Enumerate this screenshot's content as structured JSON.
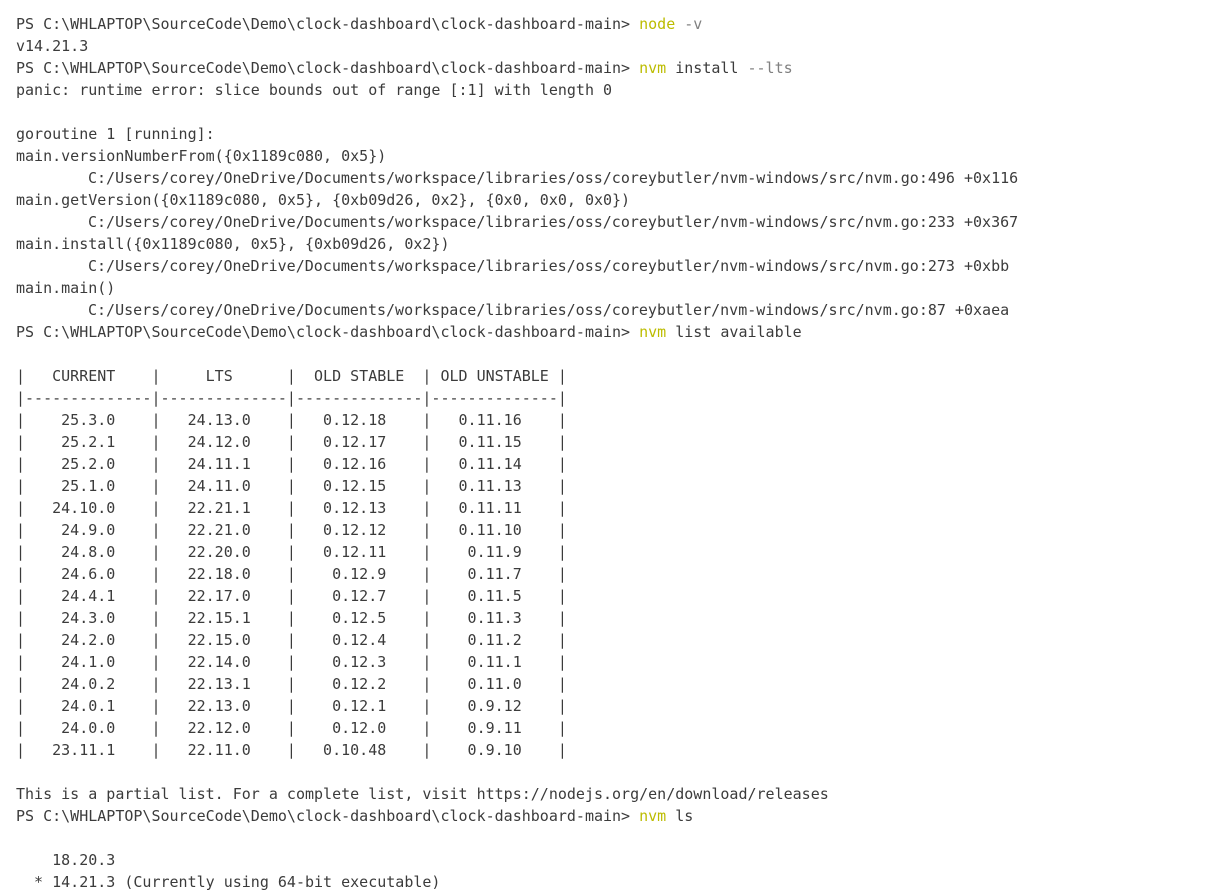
{
  "prompt": "PS C:\\WHLAPTOP\\SourceCode\\Demo\\clock-dashboard\\clock-dashboard-main> ",
  "colors": {
    "background": "#ffffff",
    "text": "#3b3b3b",
    "command": "#bcbc00",
    "argument": "#808080"
  },
  "lines": [
    {
      "type": "prompt",
      "cmd": "node",
      "arg": " -v"
    },
    {
      "type": "text",
      "text": "v14.21.3"
    },
    {
      "type": "prompt",
      "cmd": "nvm",
      "plain": " install",
      "arg": " --lts"
    },
    {
      "type": "text",
      "text": "panic: runtime error: slice bounds out of range [:1] with length 0"
    },
    {
      "type": "text",
      "text": ""
    },
    {
      "type": "text",
      "text": "goroutine 1 [running]:"
    },
    {
      "type": "text",
      "text": "main.versionNumberFrom({0x1189c080, 0x5})"
    },
    {
      "type": "indent",
      "text": "C:/Users/corey/OneDrive/Documents/workspace/libraries/oss/coreybutler/nvm-windows/src/nvm.go:496 +0x116"
    },
    {
      "type": "text",
      "text": "main.getVersion({0x1189c080, 0x5}, {0xb09d26, 0x2}, {0x0, 0x0, 0x0})"
    },
    {
      "type": "indent",
      "text": "C:/Users/corey/OneDrive/Documents/workspace/libraries/oss/coreybutler/nvm-windows/src/nvm.go:233 +0x367"
    },
    {
      "type": "text",
      "text": "main.install({0x1189c080, 0x5}, {0xb09d26, 0x2})"
    },
    {
      "type": "indent",
      "text": "C:/Users/corey/OneDrive/Documents/workspace/libraries/oss/coreybutler/nvm-windows/src/nvm.go:273 +0xbb"
    },
    {
      "type": "text",
      "text": "main.main()"
    },
    {
      "type": "indent",
      "text": "C:/Users/corey/OneDrive/Documents/workspace/libraries/oss/coreybutler/nvm-windows/src/nvm.go:87 +0xaea"
    },
    {
      "type": "prompt",
      "cmd": "nvm",
      "plain": " list available"
    },
    {
      "type": "text",
      "text": ""
    },
    {
      "type": "text",
      "text": "|   CURRENT    |     LTS      |  OLD STABLE  | OLD UNSTABLE |"
    },
    {
      "type": "text",
      "text": "|--------------|--------------|--------------|--------------|"
    },
    {
      "type": "text",
      "text": "|    25.3.0    |   24.13.0    |   0.12.18    |   0.11.16    |"
    },
    {
      "type": "text",
      "text": "|    25.2.1    |   24.12.0    |   0.12.17    |   0.11.15    |"
    },
    {
      "type": "text",
      "text": "|    25.2.0    |   24.11.1    |   0.12.16    |   0.11.14    |"
    },
    {
      "type": "text",
      "text": "|    25.1.0    |   24.11.0    |   0.12.15    |   0.11.13    |"
    },
    {
      "type": "text",
      "text": "|   24.10.0    |   22.21.1    |   0.12.13    |   0.11.11    |"
    },
    {
      "type": "text",
      "text": "|    24.9.0    |   22.21.0    |   0.12.12    |   0.11.10    |"
    },
    {
      "type": "text",
      "text": "|    24.8.0    |   22.20.0    |   0.12.11    |    0.11.9    |"
    },
    {
      "type": "text",
      "text": "|    24.6.0    |   22.18.0    |    0.12.9    |    0.11.7    |"
    },
    {
      "type": "text",
      "text": "|    24.4.1    |   22.17.0    |    0.12.7    |    0.11.5    |"
    },
    {
      "type": "text",
      "text": "|    24.3.0    |   22.15.1    |    0.12.5    |    0.11.3    |"
    },
    {
      "type": "text",
      "text": "|    24.2.0    |   22.15.0    |    0.12.4    |    0.11.2    |"
    },
    {
      "type": "text",
      "text": "|    24.1.0    |   22.14.0    |    0.12.3    |    0.11.1    |"
    },
    {
      "type": "text",
      "text": "|    24.0.2    |   22.13.1    |    0.12.2    |    0.11.0    |"
    },
    {
      "type": "text",
      "text": "|    24.0.1    |   22.13.0    |    0.12.1    |    0.9.12    |"
    },
    {
      "type": "text",
      "text": "|    24.0.0    |   22.12.0    |    0.12.0    |    0.9.11    |"
    },
    {
      "type": "text",
      "text": "|   23.11.1    |   22.11.0    |   0.10.48    |    0.9.10    |"
    },
    {
      "type": "text",
      "text": ""
    },
    {
      "type": "text",
      "text": "This is a partial list. For a complete list, visit https://nodejs.org/en/download/releases"
    },
    {
      "type": "prompt",
      "cmd": "nvm",
      "plain": " ls"
    },
    {
      "type": "text",
      "text": ""
    },
    {
      "type": "text",
      "text": "    18.20.3"
    },
    {
      "type": "text",
      "text": "  * 14.21.3 (Currently using 64-bit executable)"
    }
  ]
}
